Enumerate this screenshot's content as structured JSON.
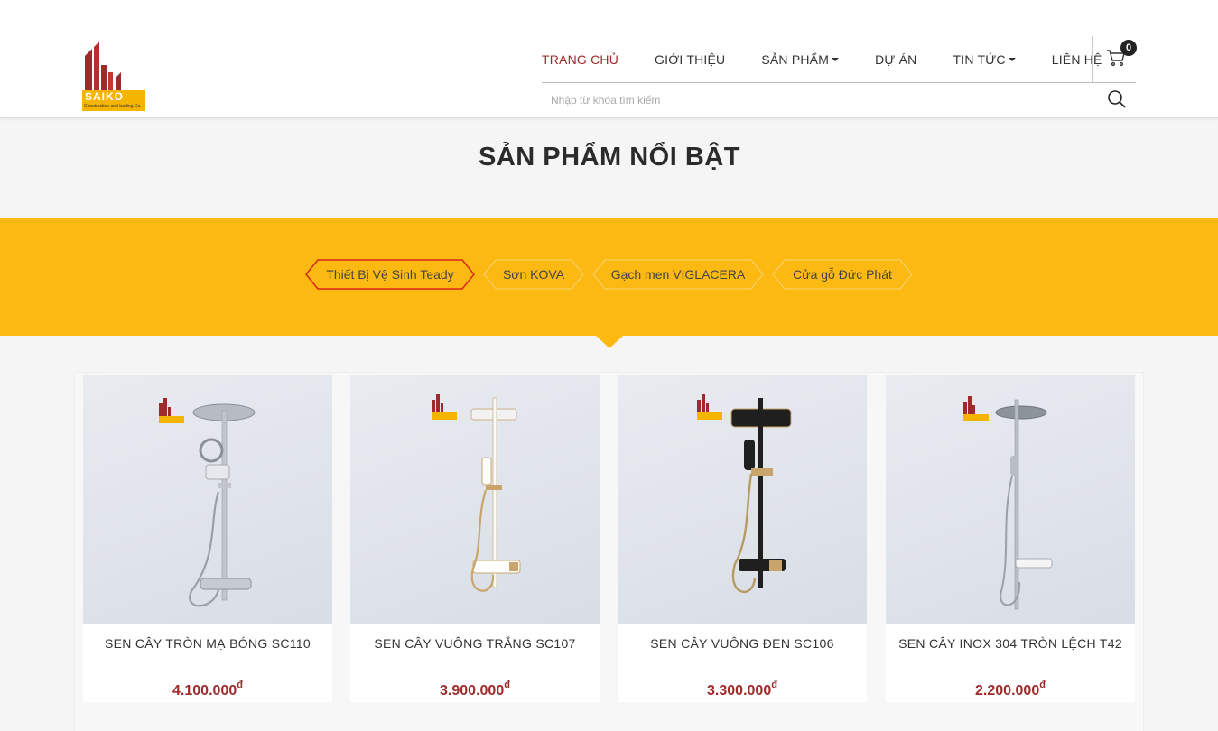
{
  "header": {
    "logo": {
      "text": "SAIKO",
      "subtext": "Construction and trading Co."
    },
    "nav": [
      {
        "label": "TRANG CHỦ",
        "active": true,
        "dropdown": false
      },
      {
        "label": "GIỚI THIỆU",
        "active": false,
        "dropdown": false
      },
      {
        "label": "SẢN PHẨM",
        "active": false,
        "dropdown": true
      },
      {
        "label": "DỰ ÁN",
        "active": false,
        "dropdown": false
      },
      {
        "label": "TIN TỨC",
        "active": false,
        "dropdown": true
      },
      {
        "label": "LIÊN HỆ",
        "active": false,
        "dropdown": false
      }
    ],
    "cart": {
      "count": "0",
      "icon": "cart-icon"
    },
    "search": {
      "placeholder": "Nhập từ khóa tìm kiếm",
      "value": "",
      "icon": "search-icon"
    }
  },
  "section": {
    "title": "SẢN PHẨM NỔI BẬT"
  },
  "tabs": [
    {
      "label": "Thiết Bị Vệ Sinh Teady",
      "active": true
    },
    {
      "label": "Sơn KOVA",
      "active": false
    },
    {
      "label": "Gạch men VIGLACERA",
      "active": false
    },
    {
      "label": "Cửa gỗ Đức Phát",
      "active": false
    }
  ],
  "products": [
    {
      "name": "SEN CÂY TRÒN MẠ BÓNG SC110",
      "price": "4.100.000",
      "currency": "đ",
      "finish": "chrome"
    },
    {
      "name": "SEN CÂY VUÔNG TRẮNG SC107",
      "price": "3.900.000",
      "currency": "đ",
      "finish": "white-gold"
    },
    {
      "name": "SEN CÂY VUÔNG ĐEN SC106",
      "price": "3.300.000",
      "currency": "đ",
      "finish": "black-gold"
    },
    {
      "name": "SEN CÂY INOX 304 TRÒN LỆCH T42",
      "price": "2.200.000",
      "currency": "đ",
      "finish": "steel"
    }
  ],
  "colors": {
    "brand": "#9e2a2b",
    "accent": "#fcb912"
  }
}
